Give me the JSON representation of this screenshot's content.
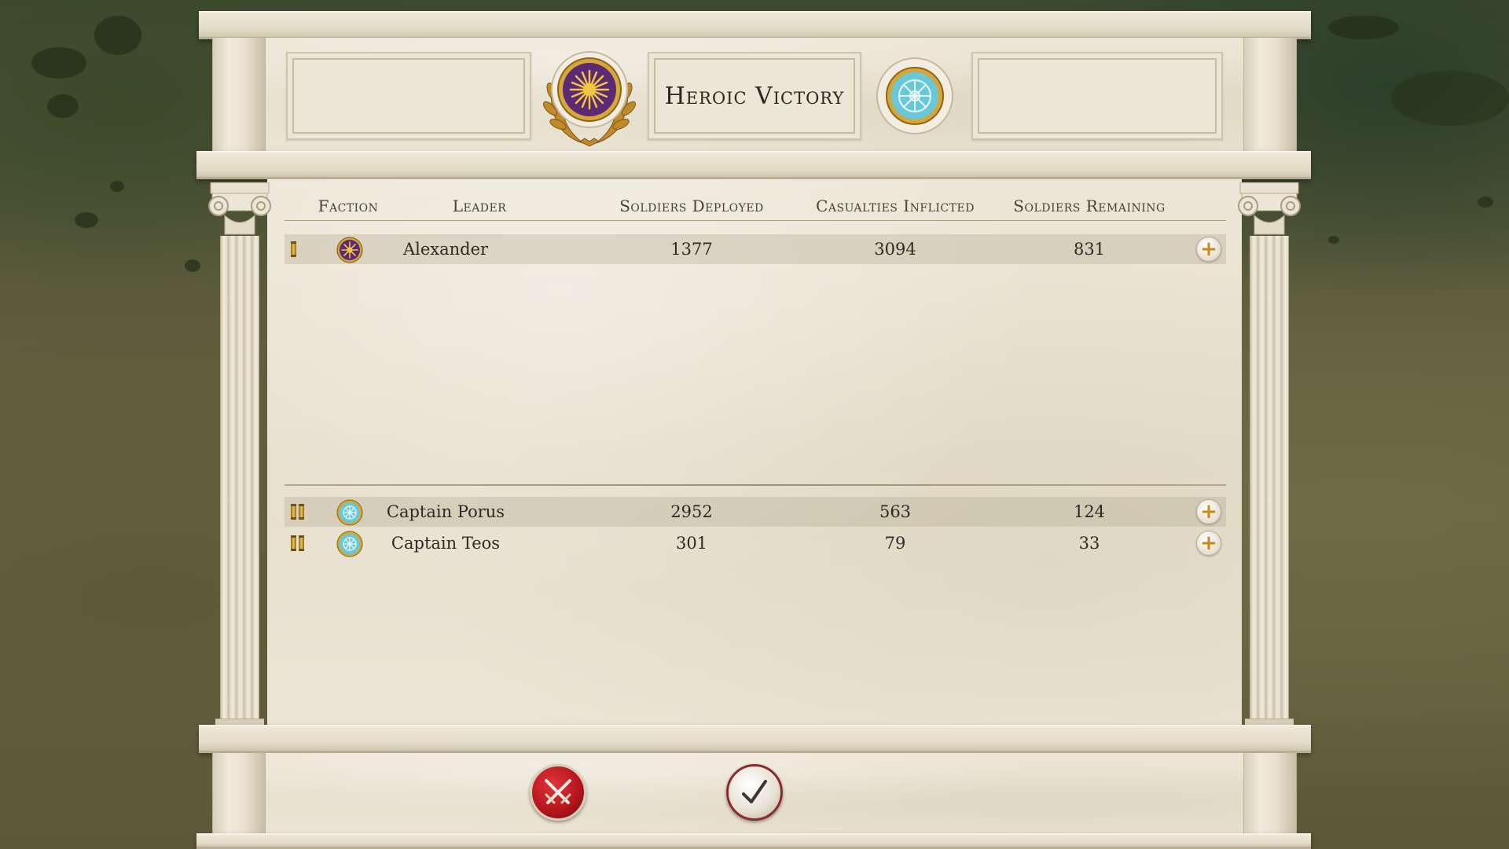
{
  "header": {
    "title": "Heroic Victory",
    "player_emblem_icon": "vergina-sun-purple-icon",
    "enemy_emblem_icon": "wheel-emblem-cyan-icon"
  },
  "table": {
    "columns": {
      "faction": "Faction",
      "leader": "Leader",
      "soldiers_deployed": "Soldiers Deployed",
      "casualties_inflicted": "Casualties Inflicted",
      "soldiers_remaining": "Soldiers Remaining"
    },
    "player_rows": [
      {
        "rank": "I",
        "faction_icon": "vergina-sun-purple-icon",
        "leader": "Alexander",
        "deployed": "1377",
        "inflicted": "3094",
        "remaining": "831"
      }
    ],
    "enemy_rows": [
      {
        "rank": "II",
        "faction_icon": "wheel-emblem-cyan-icon",
        "leader": "Captain Porus",
        "deployed": "2952",
        "inflicted": "563",
        "remaining": "124"
      },
      {
        "rank": "II",
        "faction_icon": "wheel-emblem-cyan-icon",
        "leader": "Captain Teos",
        "deployed": "301",
        "inflicted": "79",
        "remaining": "33"
      }
    ]
  },
  "footer": {
    "cancel_icon": "crossed-swords-icon",
    "confirm_icon": "checkmark-icon"
  },
  "colors": {
    "player_faction": "#5b2a73",
    "player_sun": "#f2c640",
    "enemy_faction": "#66c8d8",
    "enemy_ring": "#d6a63a",
    "gold_plus": "#c88a14",
    "cancel_red": "#b3141c"
  }
}
